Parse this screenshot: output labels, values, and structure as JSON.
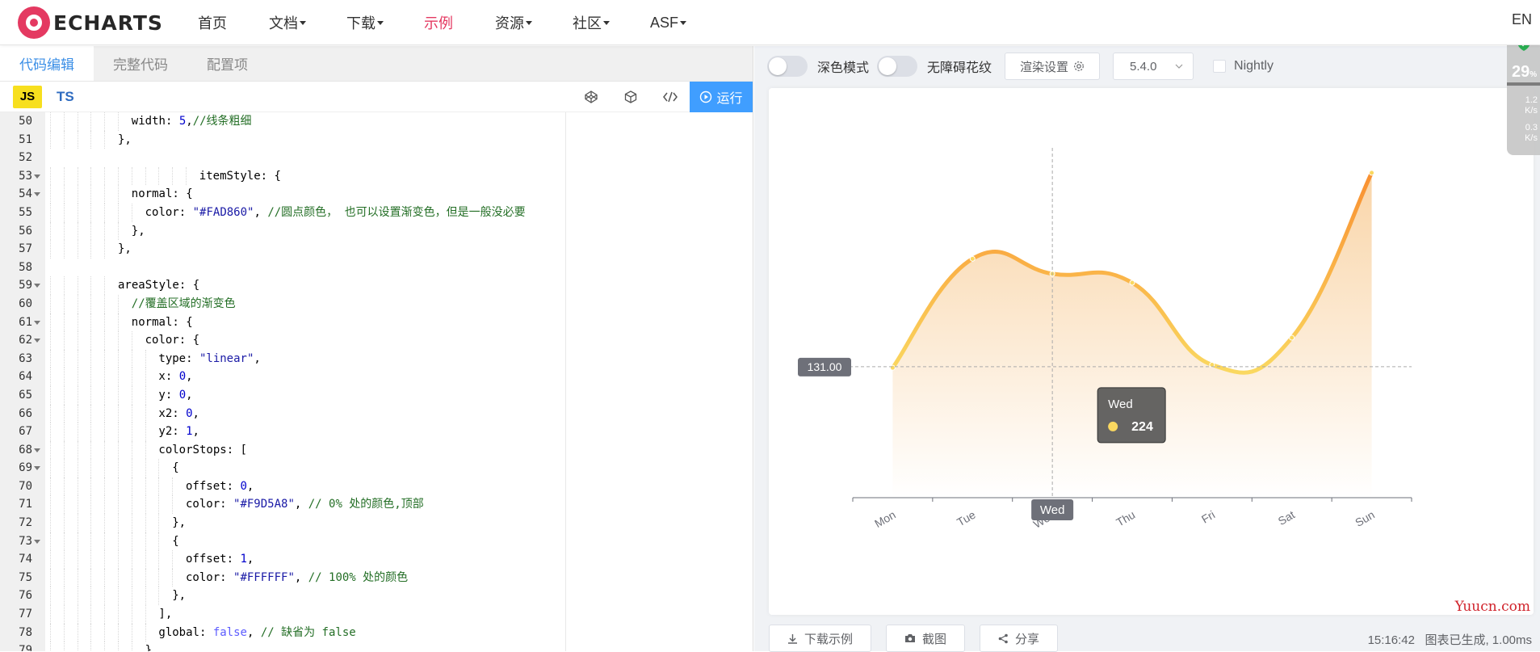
{
  "nav": {
    "logo_text": "ECHARTS",
    "items": [
      {
        "label": "首页",
        "dropdown": false,
        "active": false
      },
      {
        "label": "文档",
        "dropdown": true,
        "active": false
      },
      {
        "label": "下载",
        "dropdown": true,
        "active": false
      },
      {
        "label": "示例",
        "dropdown": false,
        "active": true
      },
      {
        "label": "资源",
        "dropdown": true,
        "active": false
      },
      {
        "label": "社区",
        "dropdown": true,
        "active": false
      },
      {
        "label": "ASF",
        "dropdown": true,
        "active": false
      }
    ],
    "lang": "EN"
  },
  "editor": {
    "tabs": [
      "代码编辑",
      "完整代码",
      "配置项"
    ],
    "active_tab": 0,
    "lang_js": "JS",
    "lang_ts": "TS",
    "run_label": "运行",
    "lines": [
      {
        "n": "50",
        "fold": false,
        "indent": 6,
        "html": "<span class='c-key'>width</span>: <span class='c-num'>5</span>,<span class='c-com'>//线条粗细</span>"
      },
      {
        "n": "51",
        "fold": false,
        "indent": 5,
        "html": "},"
      },
      {
        "n": "52",
        "fold": false,
        "indent": 0,
        "html": ""
      },
      {
        "n": "53",
        "fold": true,
        "indent": 11,
        "html": "<span class='c-key'>itemStyle</span>: {"
      },
      {
        "n": "54",
        "fold": true,
        "indent": 6,
        "html": "<span class='c-key'>normal</span>: {"
      },
      {
        "n": "55",
        "fold": false,
        "indent": 7,
        "html": "<span class='c-key'>color</span>: <span class='c-str'>\"#FAD860\"</span>, <span class='c-com'>//圆点颜色， 也可以设置渐变色，但是一般没必要</span>"
      },
      {
        "n": "56",
        "fold": false,
        "indent": 6,
        "html": "},"
      },
      {
        "n": "57",
        "fold": false,
        "indent": 5,
        "html": "},"
      },
      {
        "n": "58",
        "fold": false,
        "indent": 0,
        "html": ""
      },
      {
        "n": "59",
        "fold": true,
        "indent": 5,
        "html": "<span class='c-key'>areaStyle</span>: {"
      },
      {
        "n": "60",
        "fold": false,
        "indent": 6,
        "html": "<span class='c-com'>//覆盖区域的渐变色</span>"
      },
      {
        "n": "61",
        "fold": true,
        "indent": 6,
        "html": "<span class='c-key'>normal</span>: {"
      },
      {
        "n": "62",
        "fold": true,
        "indent": 7,
        "html": "<span class='c-key'>color</span>: {"
      },
      {
        "n": "63",
        "fold": false,
        "indent": 8,
        "html": "<span class='c-key'>type</span>: <span class='c-str'>\"linear\"</span>,"
      },
      {
        "n": "64",
        "fold": false,
        "indent": 8,
        "html": "<span class='c-key'>x</span>: <span class='c-num'>0</span>,"
      },
      {
        "n": "65",
        "fold": false,
        "indent": 8,
        "html": "<span class='c-key'>y</span>: <span class='c-num'>0</span>,"
      },
      {
        "n": "66",
        "fold": false,
        "indent": 8,
        "html": "<span class='c-key'>x2</span>: <span class='c-num'>0</span>,"
      },
      {
        "n": "67",
        "fold": false,
        "indent": 8,
        "html": "<span class='c-key'>y2</span>: <span class='c-num'>1</span>,"
      },
      {
        "n": "68",
        "fold": true,
        "indent": 8,
        "html": "<span class='c-key'>colorStops</span>: ["
      },
      {
        "n": "69",
        "fold": true,
        "indent": 9,
        "html": "{"
      },
      {
        "n": "70",
        "fold": false,
        "indent": 10,
        "html": "<span class='c-key'>offset</span>: <span class='c-num'>0</span>,"
      },
      {
        "n": "71",
        "fold": false,
        "indent": 10,
        "html": "<span class='c-key'>color</span>: <span class='c-str'>\"#F9D5A8\"</span>, <span class='c-com'>// 0% 处的颜色,顶部</span>"
      },
      {
        "n": "72",
        "fold": false,
        "indent": 9,
        "html": "},"
      },
      {
        "n": "73",
        "fold": true,
        "indent": 9,
        "html": "{"
      },
      {
        "n": "74",
        "fold": false,
        "indent": 10,
        "html": "<span class='c-key'>offset</span>: <span class='c-num'>1</span>,"
      },
      {
        "n": "75",
        "fold": false,
        "indent": 10,
        "html": "<span class='c-key'>color</span>: <span class='c-str'>\"#FFFFFF\"</span>, <span class='c-com'>// 100% 处的颜色</span>"
      },
      {
        "n": "76",
        "fold": false,
        "indent": 9,
        "html": "},"
      },
      {
        "n": "77",
        "fold": false,
        "indent": 8,
        "html": "],"
      },
      {
        "n": "78",
        "fold": false,
        "indent": 8,
        "html": "<span class='c-key'>global</span>: <span class='c-kw'>false</span>, <span class='c-com'>// 缺省为 false</span>"
      },
      {
        "n": "79",
        "fold": false,
        "indent": 7,
        "html": "}"
      }
    ]
  },
  "preview": {
    "dark_mode_label": "深色模式",
    "a11y_label": "无障碍花纹",
    "render_btn": "渲染设置",
    "version": "5.4.0",
    "nightly_label": "Nightly",
    "download_btn": "下载示例",
    "screenshot_btn": "截图",
    "share_btn": "分享",
    "status_time": "15:16:42",
    "status_text": "图表已生成, 1.00ms"
  },
  "chart_data": {
    "type": "line",
    "smooth": true,
    "categories": [
      "Mon",
      "Tue",
      "Wed",
      "Thu",
      "Fri",
      "Sat",
      "Sun"
    ],
    "values": [
      130,
      239,
      224,
      215,
      133,
      160,
      325
    ],
    "ylim": [
      0,
      350
    ],
    "line_color_start": "#FAD860",
    "line_color_end": "#F98F30",
    "area_color_top": "#F9D5A8",
    "area_color_bottom": "#FFFFFF",
    "point_color": "#FAD860",
    "axis_pointer_y_label": "131.00",
    "axis_pointer_x_label": "Wed",
    "tooltip": {
      "title": "Wed",
      "value": "224"
    }
  },
  "float_widget": {
    "pct": "29",
    "pct_unit": "%",
    "up_rate": "1.2",
    "down_rate": "0.3",
    "rate_unit": "K/s"
  },
  "watermark": "Yuucn.com"
}
